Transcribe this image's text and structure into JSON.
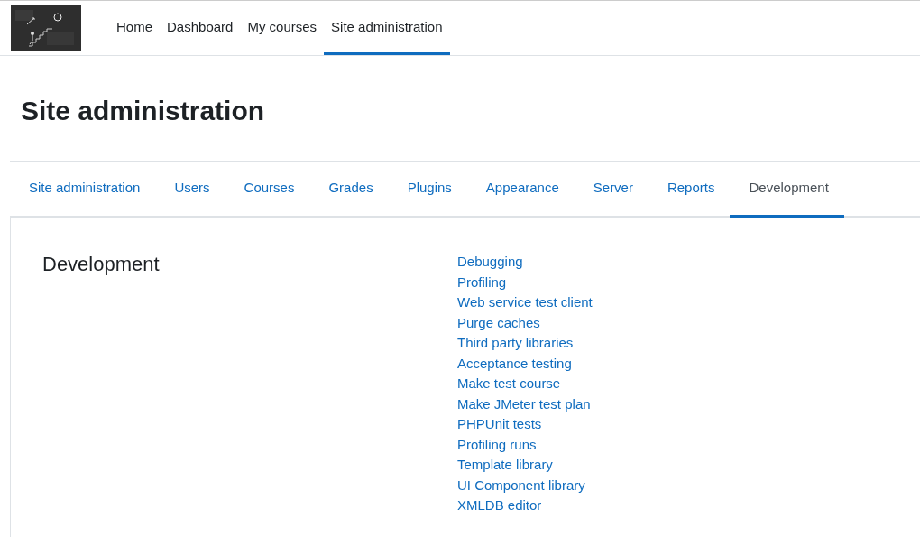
{
  "nav": [
    {
      "label": "Home",
      "selected": false
    },
    {
      "label": "Dashboard",
      "selected": false
    },
    {
      "label": "My courses",
      "selected": false
    },
    {
      "label": "Site administration",
      "selected": true
    }
  ],
  "page_title": "Site administration",
  "tabs": [
    {
      "label": "Site administration",
      "selected": false
    },
    {
      "label": "Users",
      "selected": false
    },
    {
      "label": "Courses",
      "selected": false
    },
    {
      "label": "Grades",
      "selected": false
    },
    {
      "label": "Plugins",
      "selected": false
    },
    {
      "label": "Appearance",
      "selected": false
    },
    {
      "label": "Server",
      "selected": false
    },
    {
      "label": "Reports",
      "selected": false
    },
    {
      "label": "Development",
      "selected": true
    }
  ],
  "section": {
    "title": "Development",
    "links": [
      "Debugging",
      "Profiling",
      "Web service test client",
      "Purge caches",
      "Third party libraries",
      "Acceptance testing",
      "Make test course",
      "Make JMeter test plan",
      "PHPUnit tests",
      "Profiling runs",
      "Template library",
      "UI Component library",
      "XMLDB editor"
    ]
  }
}
